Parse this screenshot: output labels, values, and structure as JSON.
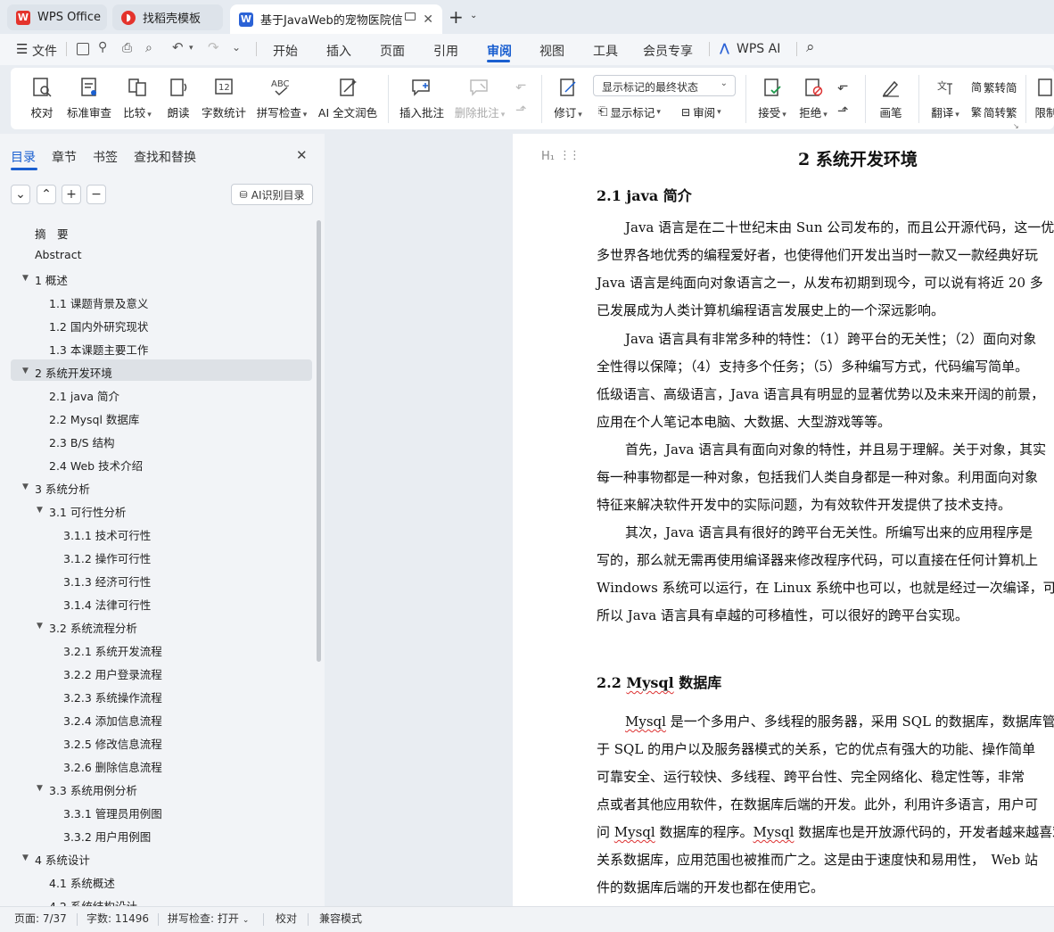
{
  "tabs": [
    {
      "label": "WPS Office",
      "icon": "wps-logo-icon"
    },
    {
      "label": "找稻壳模板",
      "icon": "docer-logo-icon"
    },
    {
      "label": "基于JavaWeb的宠物医院信息",
      "icon": "word-doc-icon"
    }
  ],
  "menu": {
    "file": "文件",
    "items": [
      "开始",
      "插入",
      "页面",
      "引用",
      "审阅",
      "视图",
      "工具",
      "会员专享"
    ],
    "active": "审阅",
    "wps_ai": "WPS AI"
  },
  "ribbon": {
    "proofread": "校对",
    "standard_review": "标准审查",
    "compare": "比较",
    "read_aloud": "朗读",
    "word_count": "字数统计",
    "spell_check": "拼写检查",
    "ai_polish": "AI 全文润色",
    "insert_comment": "插入批注",
    "delete_comment": "删除批注",
    "track_changes": "修订",
    "markup_select": "显示标记的最终状态",
    "show_markup": "显示标记",
    "review": "审阅",
    "accept": "接受",
    "reject": "拒绝",
    "pen": "画笔",
    "translate": "翻译",
    "to_simplified": "繁转简",
    "to_traditional": "简转繁",
    "restrict": "限制"
  },
  "nav": {
    "tabs": [
      "目录",
      "章节",
      "书签",
      "查找和替换"
    ],
    "ai_toc": "AI识别目录",
    "toc": [
      {
        "text": "摘　要",
        "level": 1
      },
      {
        "text": "Abstract",
        "level": 1
      },
      {
        "text": "1  概述",
        "level": 1,
        "expanded": true
      },
      {
        "text": "1.1 课题背景及意义",
        "level": 2
      },
      {
        "text": "1.2  国内外研究现状",
        "level": 2
      },
      {
        "text": "1.3  本课题主要工作",
        "level": 2
      },
      {
        "text": "2  系统开发环境",
        "level": 1,
        "expanded": true,
        "selected": true
      },
      {
        "text": "2.1 java 简介",
        "level": 2
      },
      {
        "text": "2.2 Mysql 数据库",
        "level": 2
      },
      {
        "text": "2.3 B/S 结构",
        "level": 2
      },
      {
        "text": "2.4 Web 技术介绍",
        "level": 2
      },
      {
        "text": "3  系统分析",
        "level": 1,
        "expanded": true
      },
      {
        "text": "3.1  可行性分析",
        "level": 2,
        "expanded": true
      },
      {
        "text": "3.1.1  技术可行性",
        "level": 3
      },
      {
        "text": "3.1.2 操作可行性",
        "level": 3
      },
      {
        "text": "3.1.3  经济可行性",
        "level": 3
      },
      {
        "text": "3.1.4  法律可行性",
        "level": 3
      },
      {
        "text": "3.2 系统流程分析",
        "level": 2,
        "expanded": true
      },
      {
        "text": "3.2.1 系统开发流程",
        "level": 3
      },
      {
        "text": "3.2.2  用户登录流程",
        "level": 3
      },
      {
        "text": "3.2.3  系统操作流程",
        "level": 3
      },
      {
        "text": "3.2.4  添加信息流程",
        "level": 3
      },
      {
        "text": "3.2.5  修改信息流程",
        "level": 3
      },
      {
        "text": "3.2.6  删除信息流程",
        "level": 3
      },
      {
        "text": "3.3 系统用例分析",
        "level": 2,
        "expanded": true
      },
      {
        "text": "3.3.1 管理员用例图",
        "level": 3
      },
      {
        "text": "3.3.2 用户用例图",
        "level": 3
      },
      {
        "text": "4  系统设计",
        "level": 1,
        "expanded": true
      },
      {
        "text": "4.1  系统概述",
        "level": 2
      },
      {
        "text": "4.2  系统结构设计",
        "level": 2
      }
    ]
  },
  "doc": {
    "heading_marker": "H₁",
    "chapter_title": "2  系统开发环境",
    "sec1_title": "2.1 java 简介",
    "p1": [
      "Java 语言是在二十世纪末由 Sun 公司发布的，而且公开源代码，这一优",
      "多世界各地优秀的编程爱好者，也使得他们开发出当时一款又一款经典好玩",
      "Java 语言是纯面向对象语言之一，从发布初期到现今，可以说有将近 20 多",
      "已发展成为人类计算机编程语言发展史上的一个深远影响。"
    ],
    "p2": [
      "Java 语言具有非常多种的特性：（1）跨平台的无关性；（2）面向对象",
      "全性得以保障；（4）支持多个任务；（5）多种编写方式，代码编写简单。",
      "低级语言、高级语言，Java 语言具有明显的显著优势以及未来开阔的前景，",
      "应用在个人笔记本电脑、大数据、大型游戏等等。"
    ],
    "p3": [
      "首先，Java 语言具有面向对象的特性，并且易于理解。关于对象，其实",
      "每一种事物都是一种对象，包括我们人类自身都是一种对象。利用面向对象",
      "特征来解决软件开发中的实际问题，为有效软件开发提供了技术支持。"
    ],
    "p4": [
      "其次，Java  语言具有很好的跨平台无关性。所编写出来的应用程序是",
      "写的，那么就无需再使用编译器来修改程序代码，可以直接在任何计算机上",
      "Windows 系统可以运行，在 Linux 系统中也可以，也就是经过一次编译，可",
      "所以 Java 语言具有卓越的可移植性，可以很好的跨平台实现。"
    ],
    "sec2_title_prefix": "2.2 ",
    "sec2_title_word": "Mysql",
    "sec2_title_suffix": " 数据库",
    "p5_l1_word": "Mysql",
    "p5_l1_rest": " 是一个多用户、多线程的服务器，采用 SQL 的数据库，数据库管",
    "p5": [
      "于 SQL 的用户以及服务器模式的关系，它的优点有强大的功能、操作简单",
      "可靠安全、运行较快、多线程、跨平台性、完全网络化、稳定性等，非常",
      "点或者其他应用软件，在数据库后端的开发。此外，利用许多语言，用户可"
    ],
    "p5_l5_a": "问 ",
    "p5_l5_w1": "Mysql",
    "p5_l5_b": " 数据库的程序。",
    "p5_l5_w2": "Mysql",
    "p5_l5_c": " 数据库也是开放源代码的，开发者越来越喜欢",
    "p5_tail": [
      "关系数据库，应用范围也被推而广之。这是由于速度快和易用性，　Web 站",
      "件的数据库后端的开发也都在使用它。"
    ]
  },
  "status": {
    "page": "页面: 7/37",
    "words": "字数: 11496",
    "spell": "拼写检查: 打开",
    "proof": "校对",
    "compat": "兼容模式"
  },
  "colors": {
    "accent": "#1a5fd0",
    "wps_red": "#e4332c",
    "word_blue": "#2b62d6"
  }
}
